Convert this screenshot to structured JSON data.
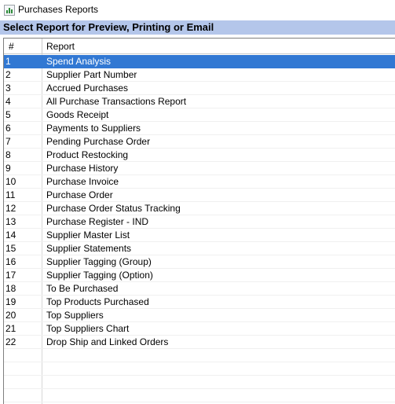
{
  "window": {
    "title": "Purchases Reports"
  },
  "header": {
    "text": "Select Report for Preview, Printing or Email"
  },
  "table": {
    "columns": [
      "#",
      "Report"
    ],
    "selected_index": 0,
    "rows": [
      {
        "num": "1",
        "report": "Spend Analysis"
      },
      {
        "num": "2",
        "report": "Supplier Part Number"
      },
      {
        "num": "3",
        "report": "Accrued Purchases"
      },
      {
        "num": "4",
        "report": "All Purchase Transactions Report"
      },
      {
        "num": "5",
        "report": "Goods Receipt"
      },
      {
        "num": "6",
        "report": "Payments to Suppliers"
      },
      {
        "num": "7",
        "report": "Pending Purchase Order"
      },
      {
        "num": "8",
        "report": "Product Restocking"
      },
      {
        "num": "9",
        "report": "Purchase History"
      },
      {
        "num": "10",
        "report": "Purchase Invoice"
      },
      {
        "num": "11",
        "report": "Purchase Order"
      },
      {
        "num": "12",
        "report": "Purchase Order Status Tracking"
      },
      {
        "num": "13",
        "report": "Purchase Register - IND"
      },
      {
        "num": "14",
        "report": "Supplier Master List"
      },
      {
        "num": "15",
        "report": "Supplier Statements"
      },
      {
        "num": "16",
        "report": "Supplier Tagging (Group)"
      },
      {
        "num": "17",
        "report": "Supplier Tagging (Option)"
      },
      {
        "num": "18",
        "report": "To Be Purchased"
      },
      {
        "num": "19",
        "report": "Top Products Purchased"
      },
      {
        "num": "20",
        "report": "Top Suppliers"
      },
      {
        "num": "21",
        "report": "Top Suppliers Chart"
      },
      {
        "num": "22",
        "report": "Drop Ship and Linked Orders"
      }
    ]
  },
  "colors": {
    "selection": "#3178d3",
    "header_band": "#b4c6ea"
  }
}
